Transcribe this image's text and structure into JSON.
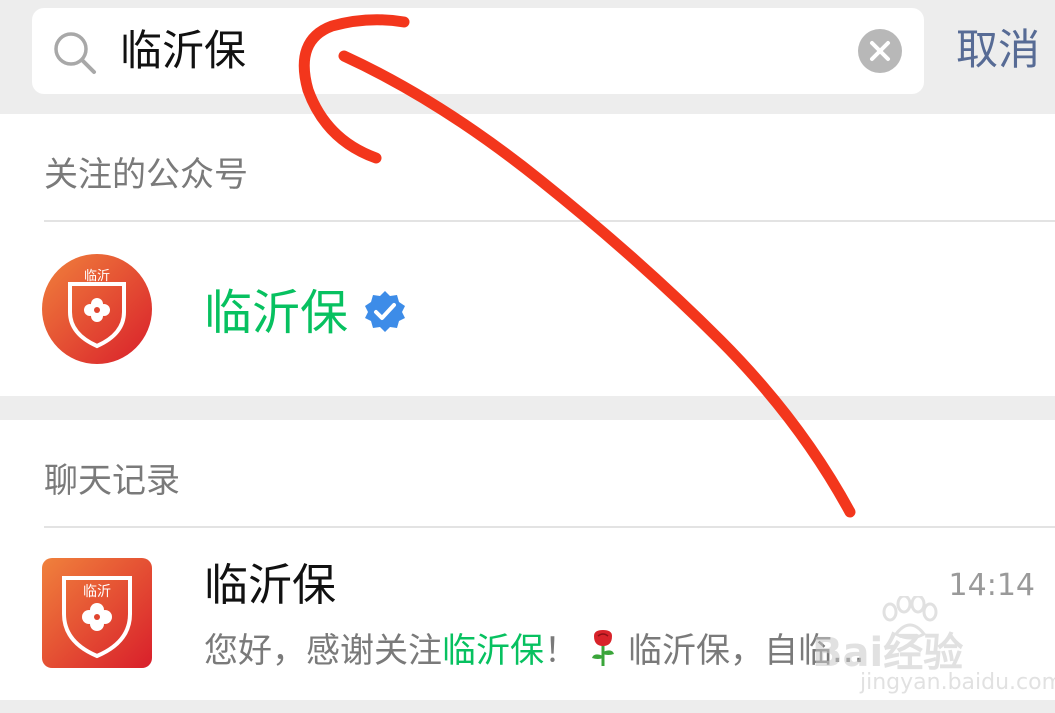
{
  "search": {
    "query": "临沂保",
    "cancel_label": "取消"
  },
  "followed_section": {
    "title": "关注的公众号",
    "account": {
      "name": "临沂保",
      "avatar_text": "临沂",
      "verified": true
    }
  },
  "chat_section": {
    "title": "聊天记录",
    "item": {
      "title": "临沂保",
      "time": "14:14",
      "preview_prefix": "您好，感谢关注",
      "preview_highlight": "临沂保",
      "preview_mid": "！",
      "preview_suffix": "临沂保，自临..."
    }
  },
  "watermark": {
    "main": "Bai经验",
    "sub": "jingyan.baidu.com"
  },
  "colors": {
    "highlight": "#07c160",
    "cancel": "#576b95",
    "annotation": "#f3361c",
    "verified": "#3d8ce8"
  },
  "icons": [
    "search-icon",
    "clear-icon",
    "verified-badge-icon",
    "rose-emoji-icon"
  ]
}
